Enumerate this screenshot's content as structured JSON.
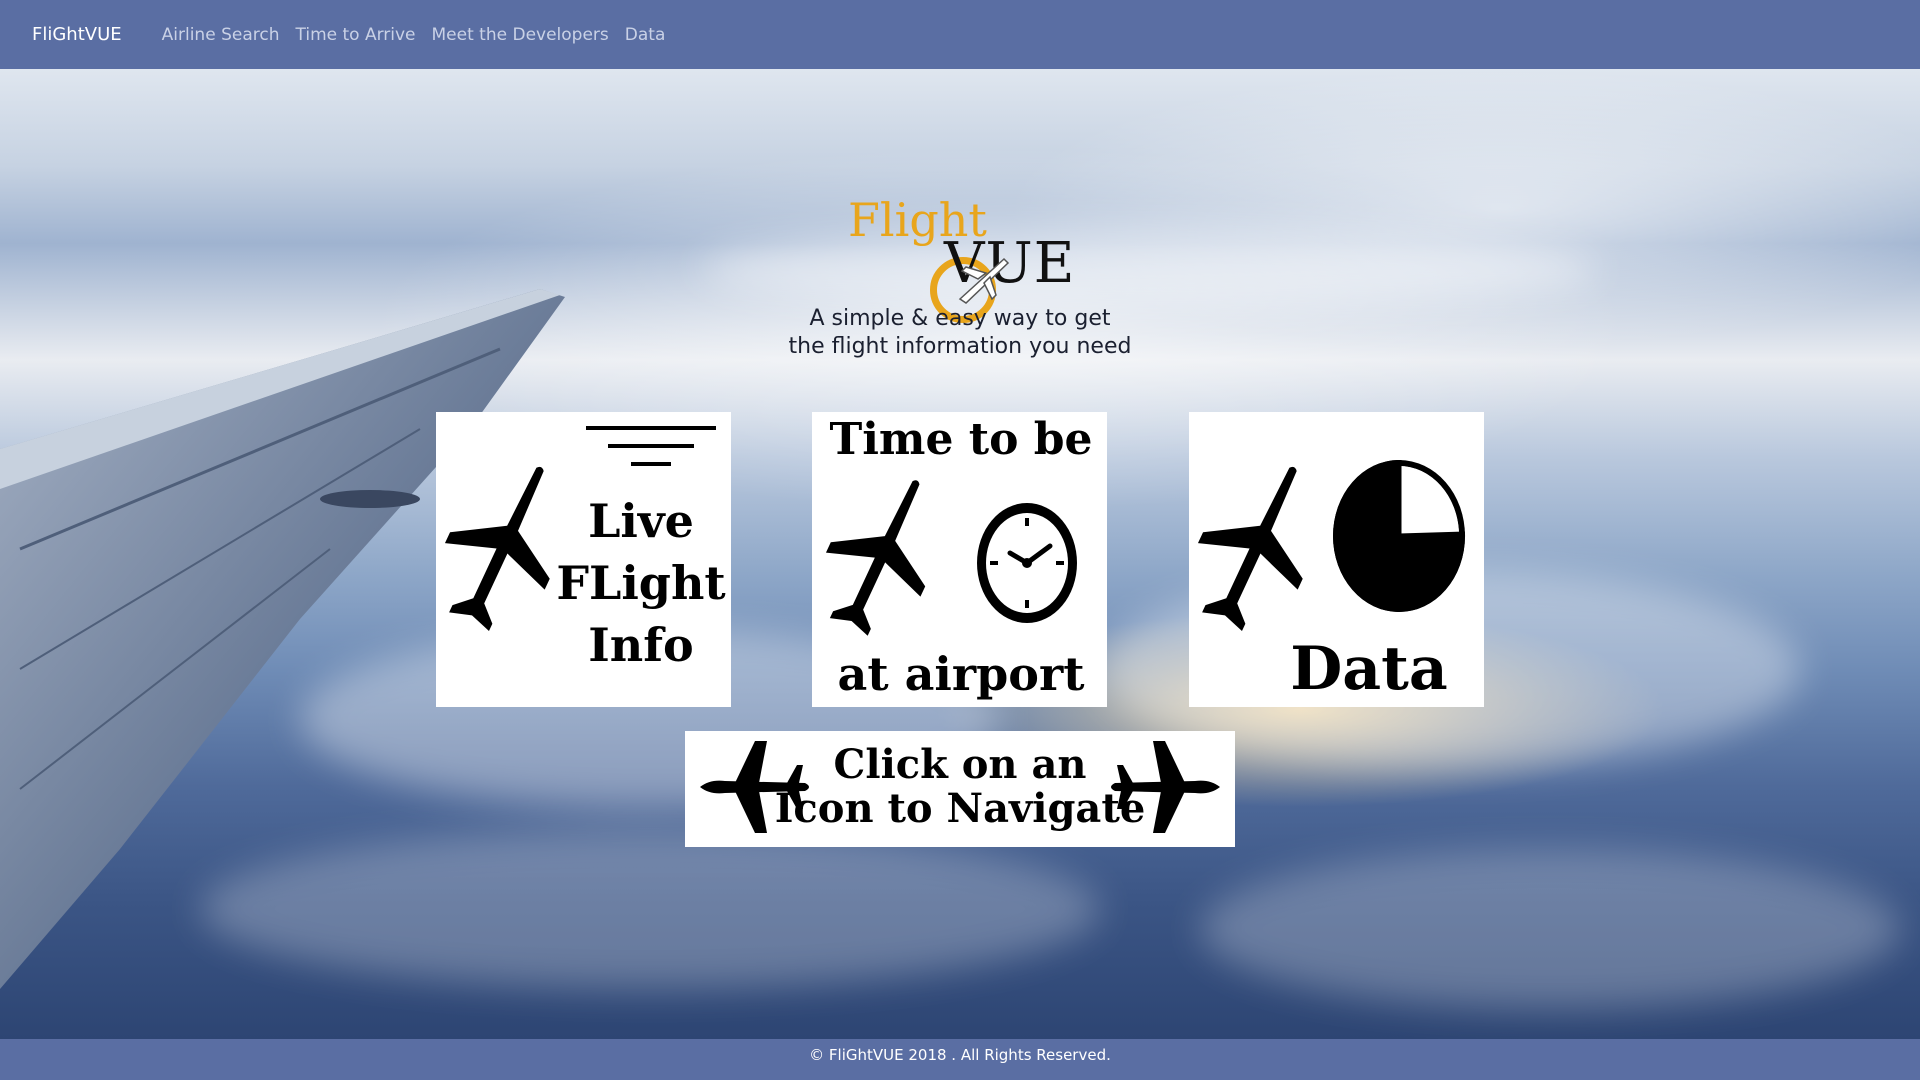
{
  "navbar": {
    "brand": "FliGhtVUE",
    "links": [
      "Airline Search",
      "Time to Arrive",
      "Meet the Developers",
      "Data"
    ]
  },
  "logo": {
    "flight_text": "Flight",
    "vue_text": "VUE"
  },
  "tagline": {
    "line1": "A simple & easy way to get",
    "line2": "the flight information you need"
  },
  "tiles": {
    "live": {
      "line1": "Live",
      "line2": "FLight",
      "line3": "Info"
    },
    "time": {
      "top": "Time to be",
      "bottom": "at airport"
    },
    "data": {
      "label": "Data"
    }
  },
  "banner": {
    "line1": "Click on an",
    "line2": "Icon to Navigate"
  },
  "footer": {
    "text": "© FliGhtVUE 2018 . All Rights Reserved."
  },
  "colors": {
    "nav_bg": "#5a6ea3",
    "logo_gold": "#e8a51c"
  }
}
